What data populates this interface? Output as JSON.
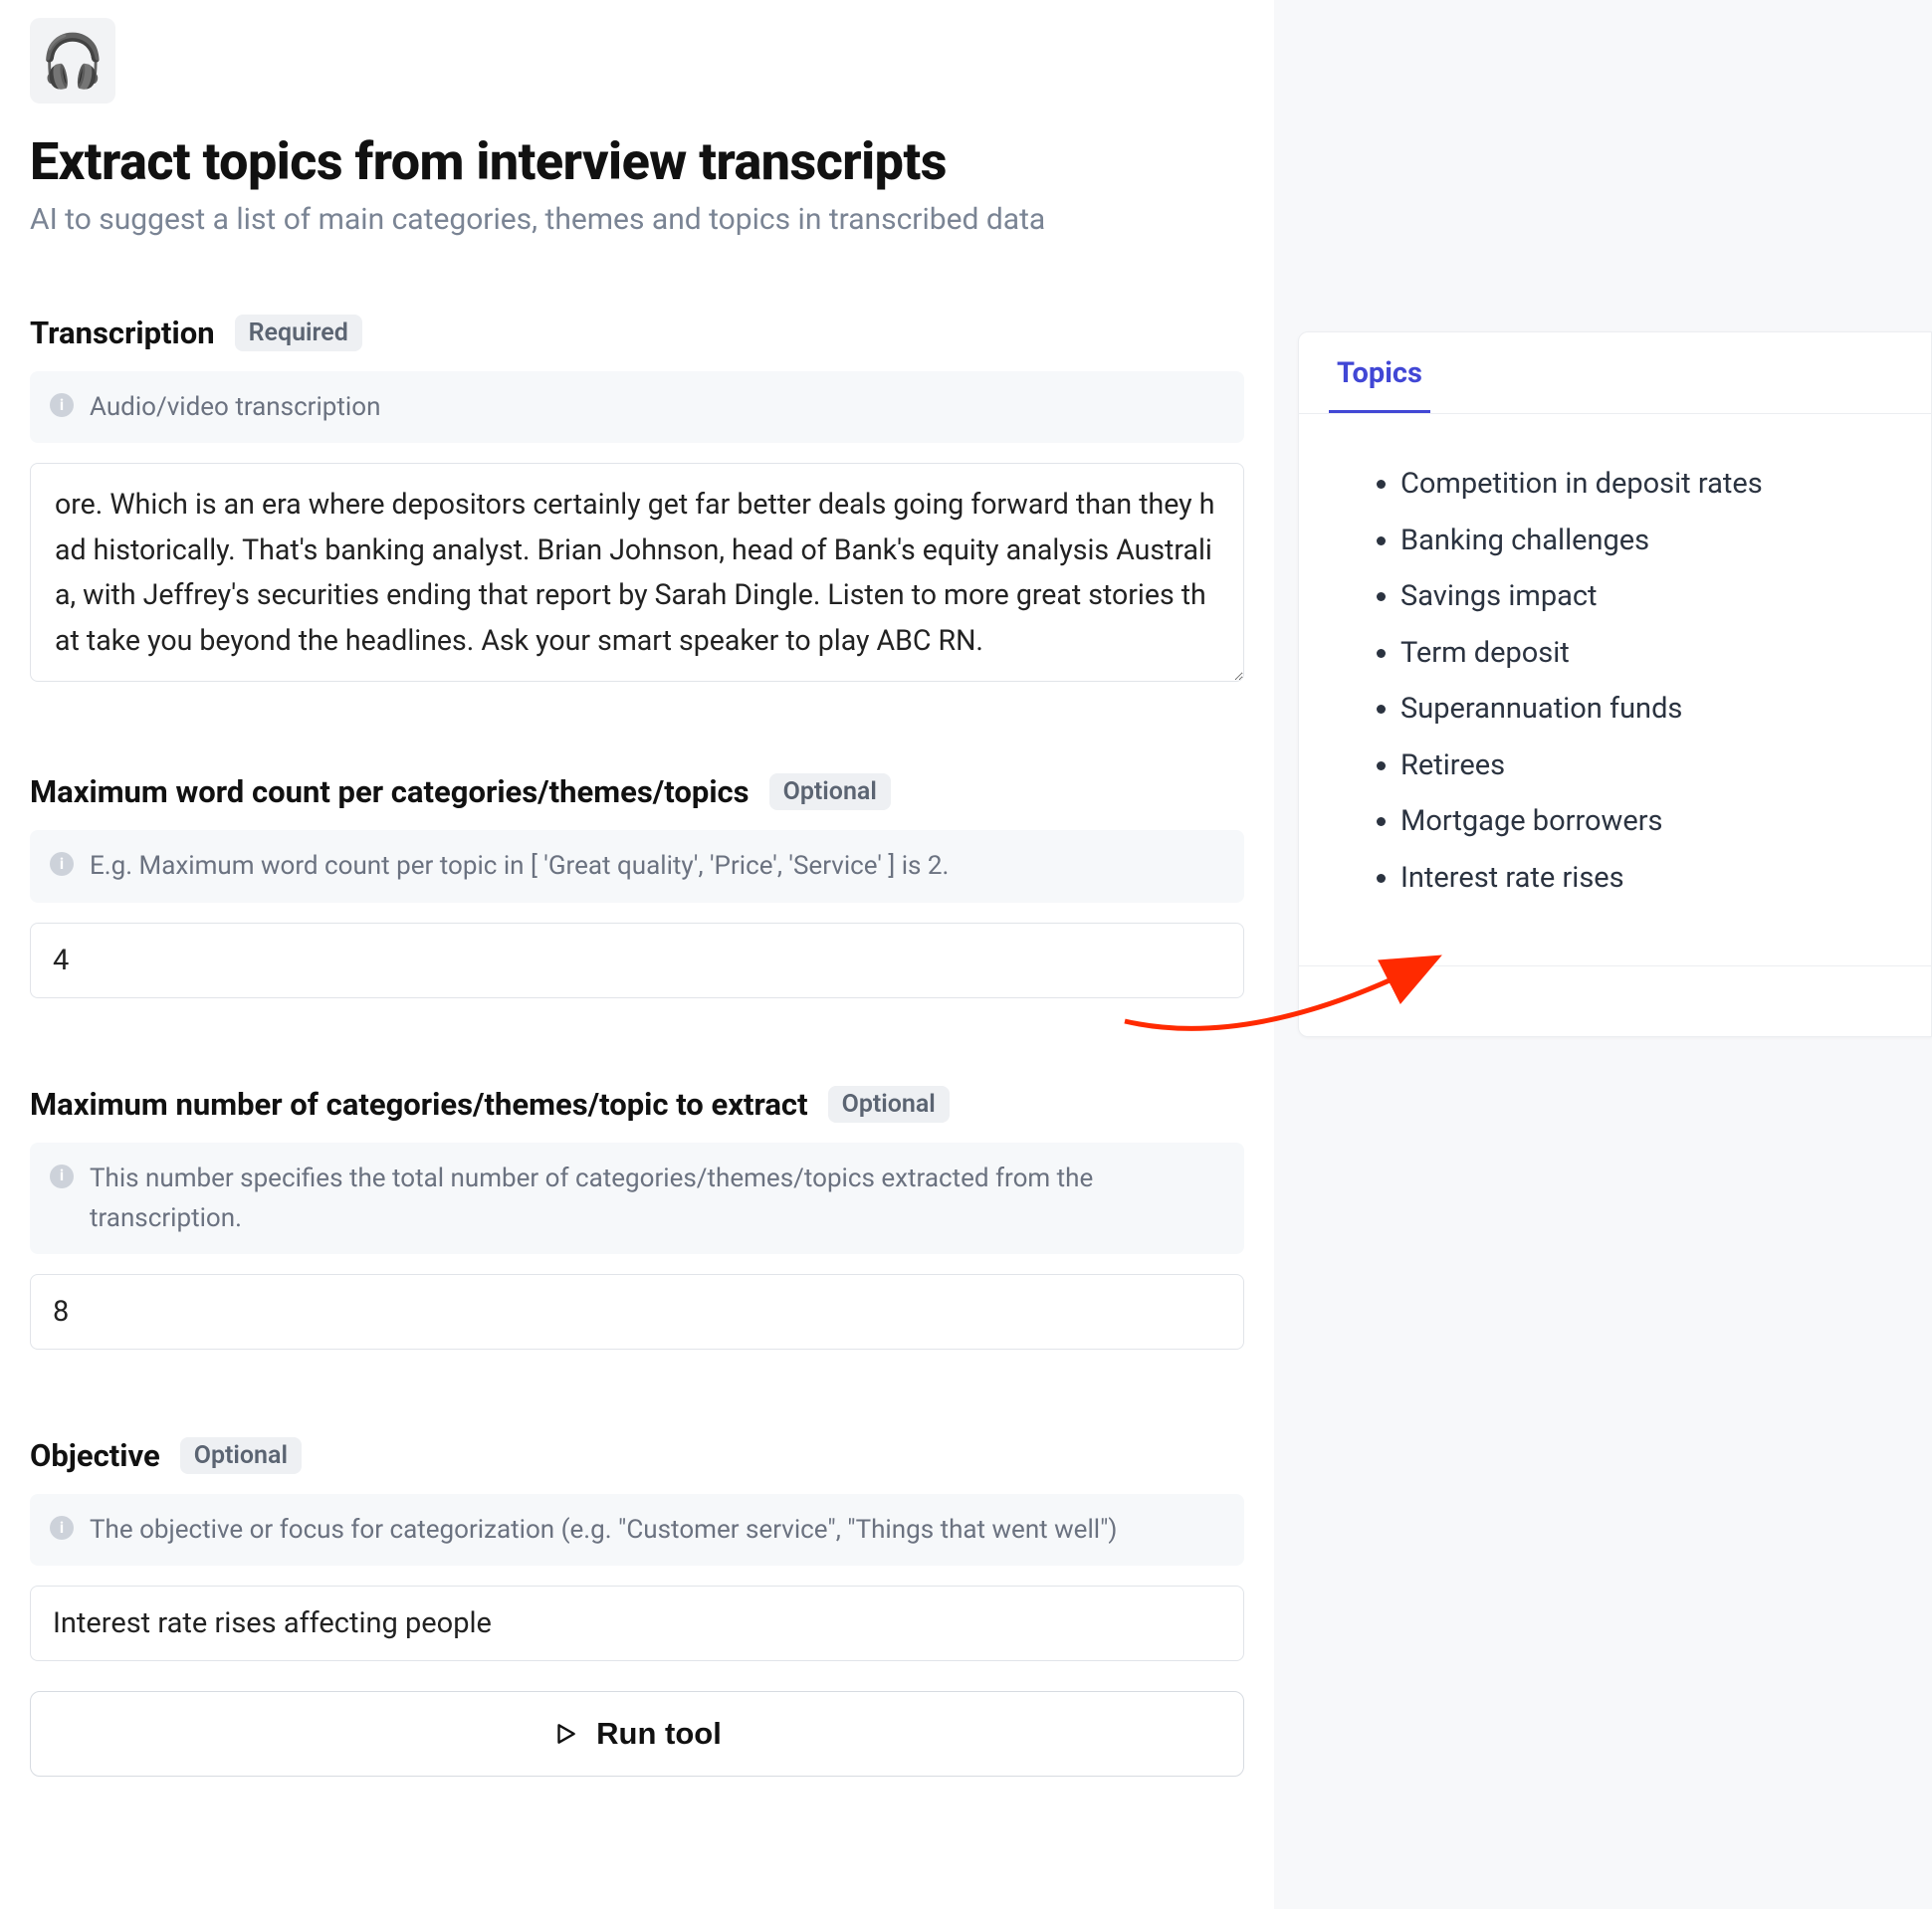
{
  "header": {
    "icon_emoji": "🎧",
    "title": "Extract topics from interview transcripts",
    "subtitle": "AI to suggest a list of main categories, themes and topics in transcribed data"
  },
  "fields": {
    "transcription": {
      "label": "Transcription",
      "badge": "Required",
      "hint": "Audio/video transcription",
      "value": "ore. Which is an era where depositors certainly get far better deals going forward than they had historically. That's banking analyst. Brian Johnson, head of Bank's equity analysis Australia, with Jeffrey's securities ending that report by Sarah Dingle. Listen to more great stories that take you beyond the headlines. Ask your smart speaker to play ABC RN."
    },
    "max_word_count": {
      "label": "Maximum word count per categories/themes/topics",
      "badge": "Optional",
      "hint": "E.g. Maximum word count per topic in [ 'Great quality', 'Price', 'Service' ] is 2.",
      "value": "4"
    },
    "max_topics": {
      "label": "Maximum number of categories/themes/topic to extract",
      "badge": "Optional",
      "hint": "This number specifies the total number of categories/themes/topics extracted from the transcription.",
      "value": "8"
    },
    "objective": {
      "label": "Objective",
      "badge": "Optional",
      "hint": "The objective or focus for categorization (e.g. \"Customer service\", \"Things that went well\")",
      "value": "Interest rate rises affecting people"
    }
  },
  "run_button_label": "Run tool",
  "result": {
    "tab_label": "Topics",
    "topics": [
      "Competition in deposit rates",
      "Banking challenges",
      "Savings impact",
      "Term deposit",
      "Superannuation funds",
      "Retirees",
      "Mortgage borrowers",
      "Interest rate rises"
    ]
  }
}
